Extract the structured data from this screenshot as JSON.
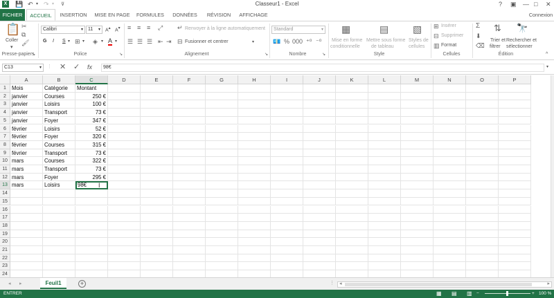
{
  "app": {
    "title": "Classeur1 - Excel",
    "account": "Connexion",
    "help": "?"
  },
  "tabs": [
    "FICHIER",
    "ACCUEIL",
    "INSERTION",
    "MISE EN PAGE",
    "FORMULES",
    "DONNÉES",
    "RÉVISION",
    "AFFICHAGE"
  ],
  "ribbon": {
    "clipboard": {
      "paste": "Coller",
      "group": "Presse-papiers"
    },
    "font": {
      "name": "Calibri",
      "size": "11",
      "group": "Police",
      "bold": "G",
      "italic": "I",
      "underline": "S"
    },
    "alignment": {
      "wrap": "Renvoyer à la ligne automatiquement",
      "merge": "Fusionner et centrer",
      "group": "Alignement"
    },
    "number": {
      "format": "Standard",
      "group": "Nombre"
    },
    "style": {
      "conditional_1": "Mise en forme",
      "conditional_2": "conditionnelle",
      "table_1": "Mettre sous forme",
      "table_2": "de tableau",
      "cell_1": "Styles de",
      "cell_2": "cellules",
      "group": "Style"
    },
    "cells": {
      "insert": "Insérer",
      "delete": "Supprimer",
      "format": "Format",
      "group": "Cellules"
    },
    "editing": {
      "sort_1": "Trier et",
      "sort_2": "filtrer",
      "find_1": "Rechercher et",
      "find_2": "sélectionner",
      "group": "Édition"
    }
  },
  "formula_bar": {
    "name_box": "C13",
    "fx": "fx",
    "content": "98€"
  },
  "columns": [
    "A",
    "B",
    "C",
    "D",
    "E",
    "F",
    "G",
    "H",
    "I",
    "J",
    "K",
    "L",
    "M",
    "N",
    "O",
    "P"
  ],
  "rows": [
    [
      "Mois",
      "Catégorie",
      "Montant"
    ],
    [
      "janvier",
      "Courses",
      "250 €"
    ],
    [
      "janvier",
      "Loisirs",
      "100 €"
    ],
    [
      "janvier",
      "Transport",
      "73 €"
    ],
    [
      "janvier",
      "Foyer",
      "347 €"
    ],
    [
      "février",
      "Loisirs",
      "52 €"
    ],
    [
      "février",
      "Foyer",
      "320 €"
    ],
    [
      "février",
      "Courses",
      "315 €"
    ],
    [
      "février",
      "Transport",
      "73 €"
    ],
    [
      "mars",
      "Courses",
      "322 €"
    ],
    [
      "mars",
      "Transport",
      "73 €"
    ],
    [
      "mars",
      "Foyer",
      "295 €"
    ],
    [
      "mars",
      "Loisirs",
      "98€"
    ]
  ],
  "row_count": 24,
  "sheet": {
    "name": "Feuil1",
    "add": "+"
  },
  "status": {
    "mode": "ENTRER",
    "zoom": "100 %"
  }
}
